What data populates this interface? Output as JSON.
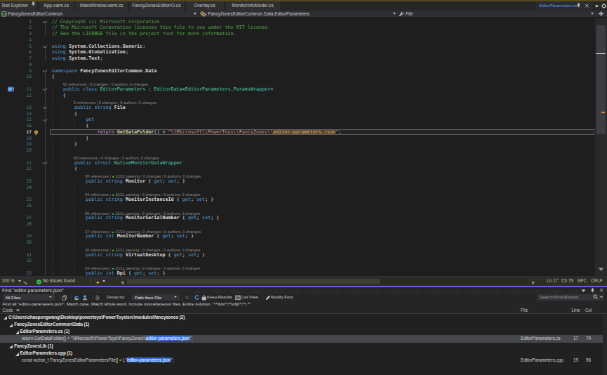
{
  "tab_bar": {
    "tabs": [
      {
        "label": "Test Explorer",
        "pinned": true
      },
      {
        "label": "App.xaml.cs"
      },
      {
        "label": "MainWindow.xaml.cs"
      },
      {
        "label": "FancyZonesEditorIO.cs"
      },
      {
        "label": "Overlay.cs"
      },
      {
        "label": "MonitorInfoModel.cs"
      }
    ],
    "preview_tab": {
      "label": "EditorParameters.cs"
    }
  },
  "nav_bar": {
    "project": "FancyZonesEditorCommon",
    "type": "FancyZonesEditorCommon.Data.EditorParameters",
    "member": "File"
  },
  "editor": {
    "current_line": 17,
    "rows": [
      {
        "n": 1,
        "fold": true,
        "toks": [
          [
            "c",
            "// Copyright (c) Microsoft Corporation"
          ]
        ]
      },
      {
        "n": 2,
        "toks": [
          [
            "c",
            "// The Microsoft Corporation licenses this file to you under the MIT license."
          ]
        ]
      },
      {
        "n": 3,
        "toks": [
          [
            "c",
            "// See the LICENSE file in the project root for more information."
          ]
        ]
      },
      {
        "n": 4,
        "toks": []
      },
      {
        "n": 5,
        "fold": true,
        "toks": [
          [
            "k",
            "using"
          ],
          [
            "pl",
            " "
          ],
          [
            "id",
            "System.Collections.Generic"
          ],
          [
            "pl",
            ";"
          ]
        ]
      },
      {
        "n": 6,
        "toks": [
          [
            "k",
            "using"
          ],
          [
            "pl",
            " "
          ],
          [
            "id",
            "System.Globalization"
          ],
          [
            "pl",
            ";"
          ]
        ]
      },
      {
        "n": 7,
        "toks": [
          [
            "k",
            "using"
          ],
          [
            "pl",
            " "
          ],
          [
            "id",
            "System.Text"
          ],
          [
            "pl",
            ";"
          ]
        ]
      },
      {
        "n": 8,
        "toks": []
      },
      {
        "n": 9,
        "fold": true,
        "toks": [
          [
            "k",
            "namespace"
          ],
          [
            "pl",
            " "
          ],
          [
            "id",
            "FancyZonesEditorCommon.Data"
          ]
        ]
      },
      {
        "n": 10,
        "toks": [
          [
            "pl",
            "{"
          ]
        ]
      },
      {
        "cl": true,
        "indent": 4,
        "parts": [
          "91 references",
          "0 changes",
          "0 authors, 0 changes"
        ]
      },
      {
        "n": 11,
        "fold": true,
        "icon": "class-info",
        "toks": [
          [
            "pl",
            "    "
          ],
          [
            "k",
            "public class"
          ],
          [
            "pl",
            " "
          ],
          [
            "t",
            "EditorParameters"
          ],
          [
            "pl",
            " : "
          ],
          [
            "t",
            "EditorData"
          ],
          [
            "pl",
            "<"
          ],
          [
            "t",
            "EditorParameters"
          ],
          [
            "pl",
            "."
          ],
          [
            "t",
            "ParamsWrapper"
          ],
          [
            "pl",
            ">"
          ]
        ]
      },
      {
        "n": 12,
        "toks": [
          [
            "pl",
            "    {"
          ]
        ]
      },
      {
        "cl": true,
        "indent": 8,
        "parts": [
          "2 references",
          "0 changes",
          "0 authors, 0 changes"
        ]
      },
      {
        "n": 13,
        "fold": true,
        "toks": [
          [
            "pl",
            "        "
          ],
          [
            "k",
            "public string"
          ],
          [
            "pl",
            " "
          ],
          [
            "id",
            "File"
          ]
        ]
      },
      {
        "n": 14,
        "toks": [
          [
            "pl",
            "        {"
          ]
        ]
      },
      {
        "n": 15,
        "fold": true,
        "toks": [
          [
            "pl",
            "            "
          ],
          [
            "k",
            "get"
          ]
        ]
      },
      {
        "n": 16,
        "toks": [
          [
            "pl",
            "            {"
          ]
        ]
      },
      {
        "n": 17,
        "bulb": true,
        "current": true,
        "toks": [
          [
            "pl",
            "                "
          ],
          [
            "ctrl",
            "return"
          ],
          [
            "pl",
            " "
          ],
          [
            "m",
            "GetDataFolder"
          ],
          [
            "pl",
            "() + "
          ],
          [
            "s",
            "\"\\\\Microsoft\\\\PowerToys\\\\FancyZones\\\\"
          ],
          [
            "shl",
            "editor-parameters.json"
          ],
          [
            "s",
            "\""
          ],
          [
            "pl",
            ";"
          ]
        ]
      },
      {
        "n": 18,
        "toks": [
          [
            "pl",
            "            }"
          ]
        ]
      },
      {
        "n": 19,
        "toks": [
          [
            "pl",
            "        }"
          ]
        ]
      },
      {
        "n": 20,
        "toks": []
      },
      {
        "cl": true,
        "indent": 8,
        "parts": [
          "60 references",
          "0 changes",
          "0 authors, 0 changes"
        ]
      },
      {
        "n": 21,
        "fold": true,
        "toks": [
          [
            "pl",
            "        "
          ],
          [
            "k",
            "public struct"
          ],
          [
            "pl",
            " "
          ],
          [
            "t",
            "NativeMonitorDataWrapper"
          ]
        ]
      },
      {
        "n": 22,
        "toks": [
          [
            "pl",
            "        {"
          ]
        ]
      },
      {
        "cl": true,
        "indent": 12,
        "parts": [
          "38 references",
          "test:12/12 passing",
          "0 changes",
          "0 authors, 0 changes"
        ]
      },
      {
        "n": 23,
        "toks": [
          [
            "pl",
            "            "
          ],
          [
            "k",
            "public string"
          ],
          [
            "pl",
            " "
          ],
          [
            "id",
            "Monitor"
          ],
          [
            "pl",
            " { "
          ],
          [
            "k",
            "get"
          ],
          [
            "pl",
            "; "
          ],
          [
            "k",
            "set"
          ],
          [
            "pl",
            "; }"
          ]
        ]
      },
      {
        "n": 24,
        "toks": []
      },
      {
        "cl": true,
        "indent": 12,
        "parts": [
          "34 references",
          "test:11/11 passing",
          "0 changes",
          "0 authors, 0 changes"
        ]
      },
      {
        "n": 25,
        "toks": [
          [
            "pl",
            "            "
          ],
          [
            "k",
            "public string"
          ],
          [
            "pl",
            " "
          ],
          [
            "id",
            "MonitorInstanceId"
          ],
          [
            "pl",
            " { "
          ],
          [
            "k",
            "get"
          ],
          [
            "pl",
            "; "
          ],
          [
            "k",
            "set"
          ],
          [
            "pl",
            "; }"
          ]
        ]
      },
      {
        "n": 26,
        "toks": []
      },
      {
        "cl": true,
        "indent": 12,
        "parts": [
          "35 references",
          "test:11/11 passing",
          "0 changes",
          "0 authors, 0 changes"
        ]
      },
      {
        "n": 27,
        "toks": [
          [
            "pl",
            "            "
          ],
          [
            "k",
            "public string"
          ],
          [
            "pl",
            " "
          ],
          [
            "id",
            "MonitorSerialNumber"
          ],
          [
            "pl",
            " { "
          ],
          [
            "k",
            "get"
          ],
          [
            "pl",
            "; "
          ],
          [
            "k",
            "set"
          ],
          [
            "pl",
            "; }"
          ]
        ]
      },
      {
        "n": 28,
        "toks": []
      },
      {
        "cl": true,
        "indent": 12,
        "parts": [
          "37 references",
          "test:13/13 passing",
          "0 changes",
          "0 authors, 0 changes"
        ]
      },
      {
        "n": 29,
        "toks": [
          [
            "pl",
            "            "
          ],
          [
            "k",
            "public int"
          ],
          [
            "pl",
            " "
          ],
          [
            "id",
            "MonitorNumber"
          ],
          [
            "pl",
            " { "
          ],
          [
            "k",
            "get"
          ],
          [
            "pl",
            "; "
          ],
          [
            "k",
            "set"
          ],
          [
            "pl",
            "; }"
          ]
        ]
      },
      {
        "n": 30,
        "toks": []
      },
      {
        "cl": true,
        "indent": 12,
        "parts": [
          "36 references",
          "test:11/11 passing",
          "0 changes",
          "0 authors, 0 changes"
        ]
      },
      {
        "n": 31,
        "toks": [
          [
            "pl",
            "            "
          ],
          [
            "k",
            "public string"
          ],
          [
            "pl",
            " "
          ],
          [
            "id",
            "VirtualDesktop"
          ],
          [
            "pl",
            " { "
          ],
          [
            "k",
            "get"
          ],
          [
            "pl",
            "; "
          ],
          [
            "k",
            "set"
          ],
          [
            "pl",
            "; }"
          ]
        ]
      },
      {
        "n": 32,
        "toks": []
      },
      {
        "cl": true,
        "indent": 12,
        "parts": [
          "34 references",
          "test:11/11 passing",
          "0 changes",
          "0 authors, 0 changes"
        ]
      },
      {
        "n": 33,
        "toks": [
          [
            "pl",
            "            "
          ],
          [
            "k",
            "public int"
          ],
          [
            "pl",
            " "
          ],
          [
            "id",
            "Dpi"
          ],
          [
            "pl",
            " { "
          ],
          [
            "k",
            "get"
          ],
          [
            "pl",
            "; "
          ],
          [
            "k",
            "set"
          ],
          [
            "pl",
            "; }"
          ]
        ]
      }
    ],
    "status_bar": {
      "zoom": "100 %",
      "health": "No issues found",
      "line": "Ln 17",
      "char": "Ch 79",
      "spaces": "SPC",
      "line_ending": "CRLF"
    }
  },
  "find_panel": {
    "title": "Find \"editor-parameters.json\"",
    "toolbar": {
      "files_filter": "All Files",
      "group_by_label": "Group by:",
      "group_by_value": "Path then File",
      "keep_results": "Keep Results",
      "list_view": "List View",
      "modify_find": "Modify Find",
      "search_placeholder": "Search Find Results"
    },
    "info": "Find all \"editor-parameters.json\", Match case, Match whole word, Include miscellaneous files, Entire solution, \"!*\\bin\\*;!*\\obj\\*;!*\\.*\"",
    "columns": {
      "code": "Code",
      "file": "File",
      "line": "Line",
      "col": "Col"
    },
    "results": [
      {
        "level": 1,
        "arrow": true,
        "bold": true,
        "text": "C:\\Users\\zhaopengwang\\Desktop\\powertoys\\PowerToys\\src\\modules\\fancyzones (2)"
      },
      {
        "level": 2,
        "arrow": true,
        "bold": true,
        "text": "FancyZonesEditorCommon\\Data (1)"
      },
      {
        "level": 3,
        "arrow": true,
        "bold": true,
        "text": "EditorParameters.cs (1)"
      },
      {
        "level": 4,
        "selected": true,
        "pre": "return GetDataFolder() + \"\\\\Microsoft\\\\PowerToys\\\\FancyZones\\\\",
        "hl": "editor-parameters.json",
        "post": "\";",
        "file": "EditorParameters.cs",
        "line": "17",
        "col": "79"
      },
      {
        "level": 2,
        "arrow": true,
        "bold": true,
        "text": "FancyZonesLib (1)"
      },
      {
        "level": 3,
        "arrow": true,
        "bold": true,
        "text": "EditorParameters.cpp (1)"
      },
      {
        "level": 4,
        "pre": "const wchar_t FancyZonesEditorParametersFile[] = L\"",
        "hl": "editor-parameters.json",
        "post": "\";",
        "file": "EditorParameters.cpp",
        "line": "19",
        "col": "56"
      }
    ]
  }
}
